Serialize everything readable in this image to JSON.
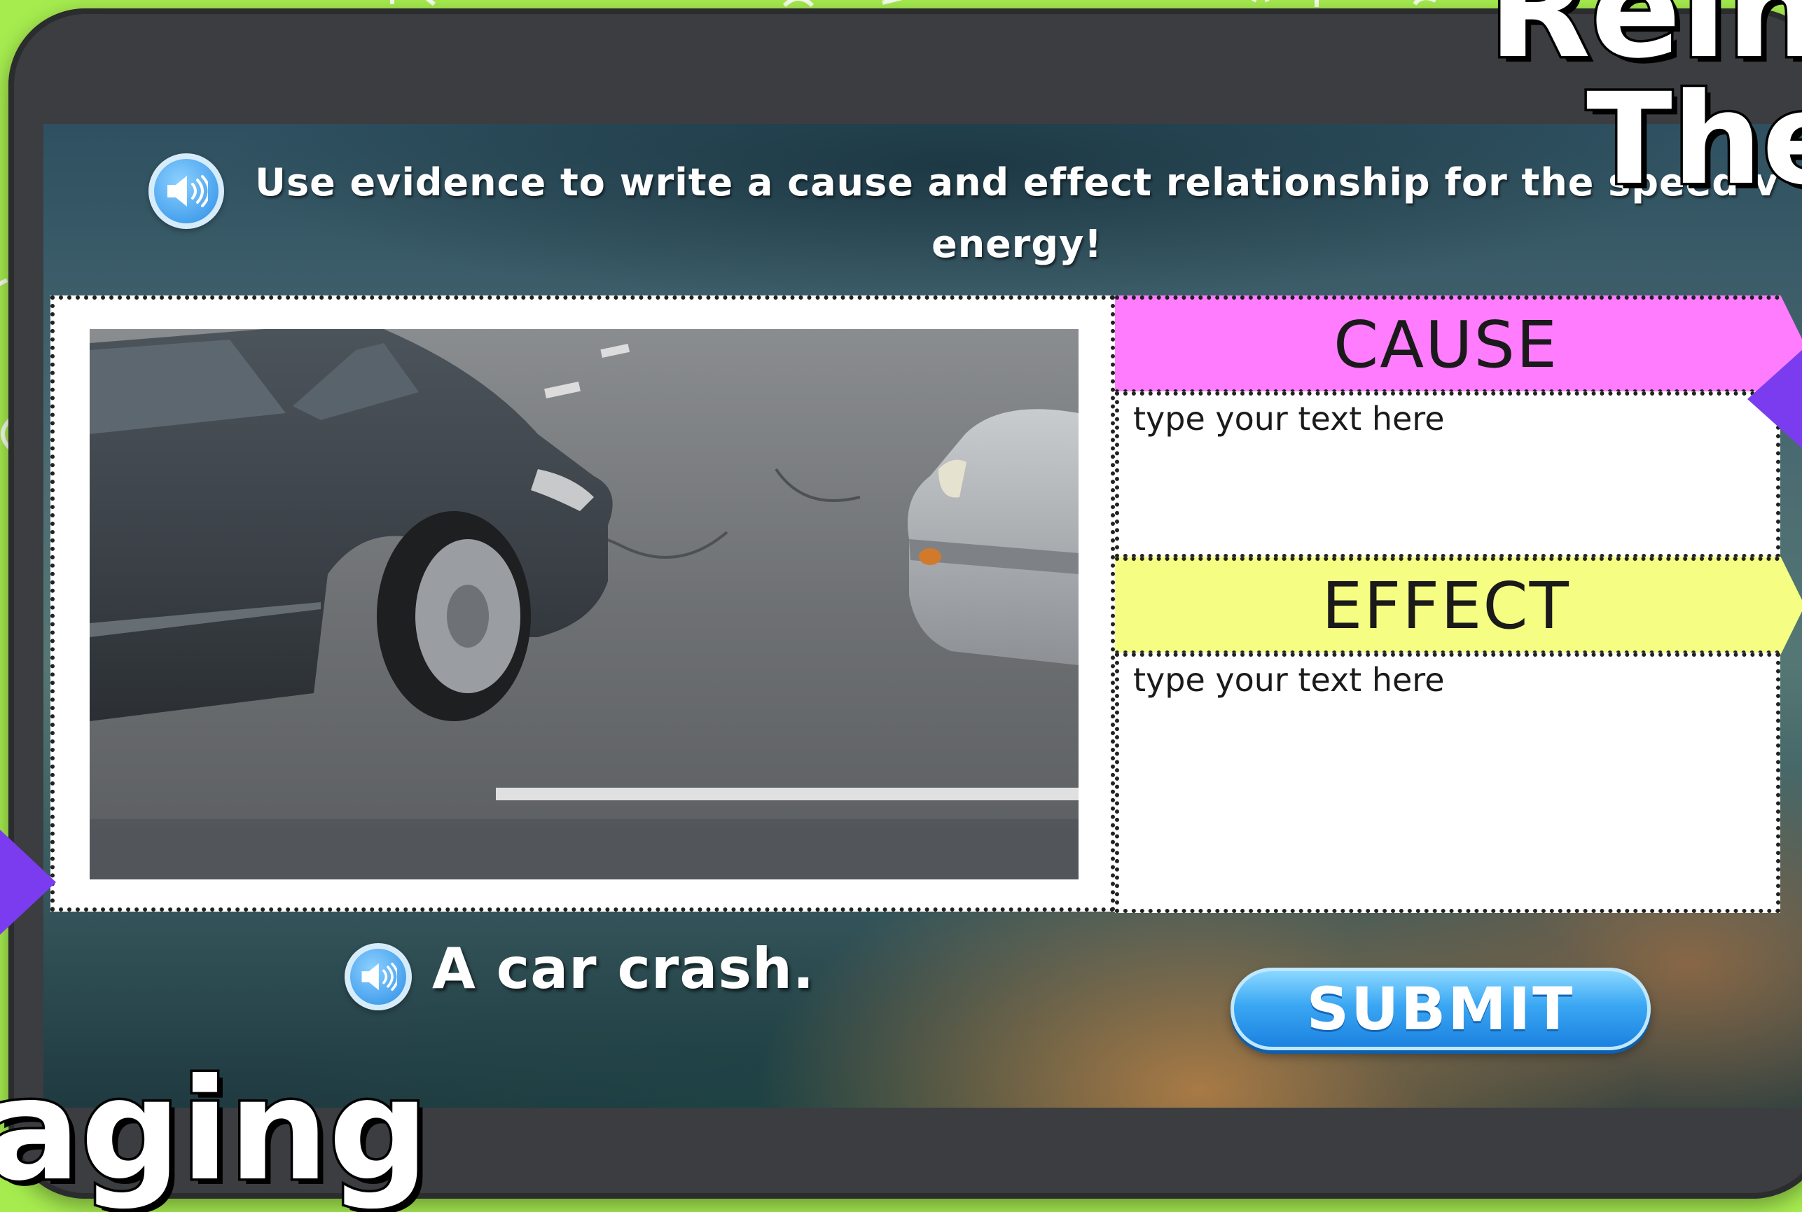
{
  "prompt": {
    "text": "Use evidence to write a cause and effect relationship for the speed v energy!",
    "sound_icon": "speaker-icon"
  },
  "photo": {
    "description_icon": "car-crash-photo"
  },
  "cause": {
    "label": "CAUSE",
    "placeholder": "type your text here",
    "color": "#ff7cff"
  },
  "effect": {
    "label": "EFFECT",
    "placeholder": "type your text here",
    "color": "#f5fd82"
  },
  "caption": {
    "text": "A car crash.",
    "sound_icon": "speaker-icon"
  },
  "submit": {
    "label": "SUBMIT",
    "color": "#2d8fe6"
  },
  "overlay": {
    "top_line1": "Rein",
    "top_line2": "The",
    "bottom": "aging"
  },
  "colors": {
    "background": "#a6ec4f",
    "accent_arrow": "#7b3cf0"
  }
}
